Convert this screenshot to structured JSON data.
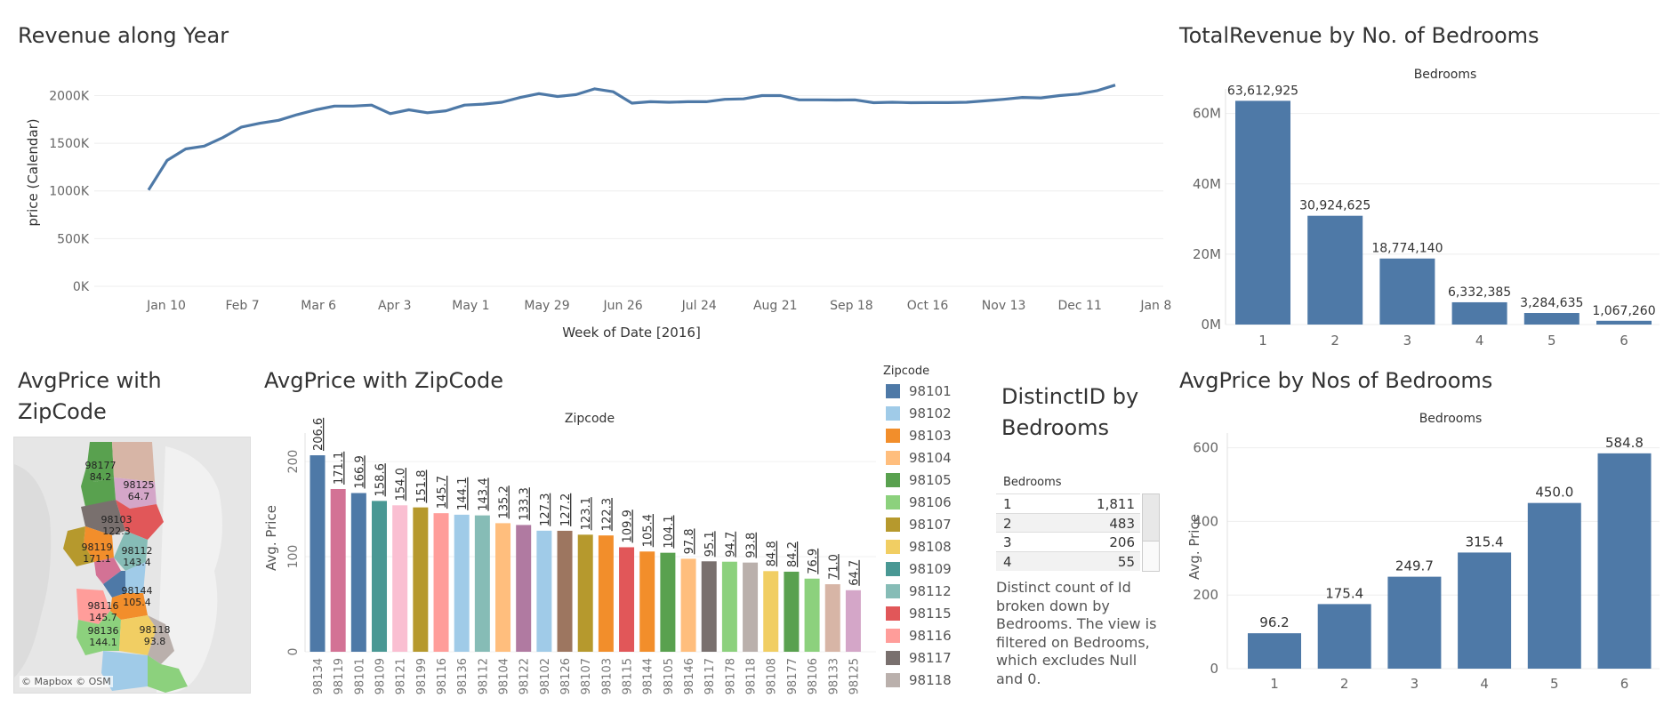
{
  "titles": {
    "revenue_year": "Revenue along Year",
    "total_revenue_bedrooms": "TotalRevenue by No. of Bedrooms",
    "avgprice_map": "AvgPrice with ZipCode",
    "avgprice_zip": "AvgPrice with ZipCode",
    "distinct_id": "DistinctID by Bedrooms",
    "avgprice_bedrooms": "AvgPrice by Nos of Bedrooms"
  },
  "legend": {
    "title": "Zipcode",
    "items": [
      {
        "zip": "98101",
        "color": "#4e79a7"
      },
      {
        "zip": "98102",
        "color": "#a0cbe8"
      },
      {
        "zip": "98103",
        "color": "#f28e2b"
      },
      {
        "zip": "98104",
        "color": "#ffbe7d"
      },
      {
        "zip": "98105",
        "color": "#59a14f"
      },
      {
        "zip": "98106",
        "color": "#8cd17d"
      },
      {
        "zip": "98107",
        "color": "#b6992d"
      },
      {
        "zip": "98108",
        "color": "#f1ce63"
      },
      {
        "zip": "98109",
        "color": "#499894"
      },
      {
        "zip": "98112",
        "color": "#86bcb6"
      },
      {
        "zip": "98115",
        "color": "#e15759"
      },
      {
        "zip": "98116",
        "color": "#ff9d9a"
      },
      {
        "zip": "98117",
        "color": "#79706e"
      },
      {
        "zip": "98118",
        "color": "#bab0ac"
      }
    ]
  },
  "distinct": {
    "header": "Bedrooms",
    "rows": [
      {
        "bedrooms": "1",
        "count": "1,811"
      },
      {
        "bedrooms": "2",
        "count": "483"
      },
      {
        "bedrooms": "3",
        "count": "206"
      },
      {
        "bedrooms": "4",
        "count": "55"
      }
    ],
    "note": "Distinct count of Id broken down by Bedrooms. The view is filtered on Bedrooms, which excludes Null and 0."
  },
  "map": {
    "attribution": "© Mapbox © OSM",
    "labels": [
      {
        "zip": "98177",
        "value": "84.2"
      },
      {
        "zip": "98125",
        "value": "64.7"
      },
      {
        "zip": "98103",
        "value": "122.3"
      },
      {
        "zip": "98119",
        "value": "171.1"
      },
      {
        "zip": "98112",
        "value": "143.4"
      },
      {
        "zip": "98144",
        "value": "105.4"
      },
      {
        "zip": "98116",
        "value": "145.7"
      },
      {
        "zip": "98136",
        "value": "144.1"
      },
      {
        "zip": "98118",
        "value": "93.8"
      }
    ]
  },
  "chart_data": [
    {
      "id": "revenue_line",
      "type": "line",
      "title": "Revenue along Year",
      "xlabel": "Week of Date [2016]",
      "ylabel": "price (Calendar)",
      "x_tick_labels": [
        "Jan 10",
        "Feb 7",
        "Mar 6",
        "Apr 3",
        "May 1",
        "May 29",
        "Jun 26",
        "Jul 24",
        "Aug 21",
        "Sep 18",
        "Oct 16",
        "Nov 13",
        "Dec 11",
        "Jan 8"
      ],
      "y_tick_labels": [
        "0K",
        "500K",
        "1000K",
        "1500K",
        "2000K"
      ],
      "y_ticks": [
        0,
        500000,
        1000000,
        1500000,
        2000000
      ],
      "ylim": [
        0,
        2200000
      ],
      "series": [
        {
          "color": "#4e79a7",
          "values": [
            1010000,
            1320000,
            1440000,
            1470000,
            1560000,
            1670000,
            1710000,
            1740000,
            1800000,
            1850000,
            1890000,
            1890000,
            1900000,
            1810000,
            1850000,
            1820000,
            1840000,
            1900000,
            1910000,
            1930000,
            1980000,
            2020000,
            1990000,
            2010000,
            2070000,
            2040000,
            1920000,
            1935000,
            1930000,
            1935000,
            1935000,
            1960000,
            1965000,
            2000000,
            2000000,
            1955000,
            1955000,
            1953000,
            1955000,
            1925000,
            1930000,
            1925000,
            1926000,
            1926000,
            1930000,
            1945000,
            1960000,
            1980000,
            1975000,
            2000000,
            2015000,
            2050000,
            2110000
          ]
        }
      ]
    },
    {
      "id": "total_revenue_bedrooms",
      "type": "bar",
      "title": "TotalRevenue by No. of Bedrooms",
      "header": "Bedrooms",
      "categories": [
        "1",
        "2",
        "3",
        "4",
        "5",
        "6"
      ],
      "values": [
        63612925,
        30924625,
        18774140,
        6332385,
        3284635,
        1067260
      ],
      "value_labels": [
        "63,612,925",
        "30,924,625",
        "18,774,140",
        "6,332,385",
        "3,284,635",
        "1,067,260"
      ],
      "y_tick_labels": [
        "0M",
        "20M",
        "40M",
        "60M"
      ],
      "y_ticks": [
        0,
        20000000,
        40000000,
        60000000
      ],
      "ylim": [
        0,
        67000000
      ],
      "color": "#4e79a7"
    },
    {
      "id": "avgprice_zip",
      "type": "bar",
      "title": "AvgPrice with ZipCode",
      "header": "Zipcode",
      "ylabel": "Avg. Price",
      "y_tick_labels": [
        "0",
        "100",
        "200"
      ],
      "y_ticks": [
        0,
        100,
        200
      ],
      "ylim": [
        0,
        230
      ],
      "categories": [
        "98134",
        "98119",
        "98101",
        "98109",
        "98121",
        "98199",
        "98116",
        "98136",
        "98112",
        "98104",
        "98122",
        "98102",
        "98126",
        "98107",
        "98103",
        "98115",
        "98144",
        "98105",
        "98146",
        "98117",
        "98178",
        "98118",
        "98108",
        "98177",
        "98106",
        "98133",
        "98125"
      ],
      "values": [
        206.6,
        171.1,
        166.9,
        158.6,
        154.0,
        151.8,
        145.7,
        144.1,
        143.4,
        135.2,
        133.3,
        127.3,
        127.2,
        123.1,
        122.3,
        109.9,
        105.4,
        104.1,
        97.8,
        95.1,
        94.7,
        93.8,
        84.8,
        84.2,
        76.9,
        71.0,
        64.7
      ],
      "value_labels": [
        "206.6",
        "171.1",
        "166.9",
        "158.6",
        "154.0",
        "151.8",
        "145.7",
        "144.1",
        "143.4",
        "135.2",
        "133.3",
        "127.3",
        "127.2",
        "123.1",
        "122.3",
        "109.9",
        "105.4",
        "104.1",
        "97.8",
        "95.1",
        "94.7",
        "93.8",
        "84.8",
        "84.2",
        "76.9",
        "71.0",
        "64.7"
      ],
      "colors": [
        "#4e79a7",
        "#d37295",
        "#4e79a7",
        "#499894",
        "#fabfd2",
        "#b6992d",
        "#ff9d9a",
        "#a0cbe8",
        "#86bcb6",
        "#ffbe7d",
        "#b07aa1",
        "#a0cbe8",
        "#9d7660",
        "#b6992d",
        "#f28e2b",
        "#e15759",
        "#f28e2b",
        "#59a14f",
        "#ffbe7d",
        "#79706e",
        "#8cd17d",
        "#bab0ac",
        "#f1ce63",
        "#59a14f",
        "#8cd17d",
        "#d7b5a6",
        "#d4a6c8"
      ]
    },
    {
      "id": "avgprice_bedrooms",
      "type": "bar",
      "title": "AvgPrice by Nos of Bedrooms",
      "header": "Bedrooms",
      "ylabel": "Avg. Price",
      "categories": [
        "1",
        "2",
        "3",
        "4",
        "5",
        "6"
      ],
      "values": [
        96.2,
        175.4,
        249.7,
        315.4,
        450.0,
        584.8
      ],
      "value_labels": [
        "96.2",
        "175.4",
        "249.7",
        "315.4",
        "450.0",
        "584.8"
      ],
      "y_tick_labels": [
        "0",
        "200",
        "400",
        "600"
      ],
      "y_ticks": [
        0,
        200,
        400,
        600
      ],
      "ylim": [
        0,
        640
      ],
      "color": "#4e79a7"
    }
  ]
}
